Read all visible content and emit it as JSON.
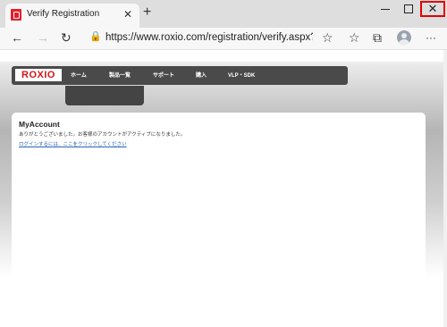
{
  "browser": {
    "tab": {
      "title": "Verify Registration",
      "close_glyph": "✕",
      "favicon": "roxio-favicon"
    },
    "new_tab_glyph": "+",
    "window_controls": {
      "close_glyph": "✕",
      "highlight_color": "#e60000"
    },
    "toolbar": {
      "back_glyph": "←",
      "forward_glyph": "→",
      "refresh_glyph": "↻",
      "lock_glyph": "🔒",
      "url": "https://www.roxio.com/registration/verify.aspx?ve...",
      "favorite_glyph": "☆",
      "favorites_list_glyph": "☆",
      "collections_glyph": "⧉"
    }
  },
  "page": {
    "logo_text": "ROXIO",
    "nav": {
      "items": [
        "ホーム",
        "製品一覧",
        "サポート",
        "購入",
        "VLP・SDK"
      ]
    },
    "card": {
      "title": "MyAccount",
      "message": "ありがとうございました。お客様のアカウントがアクティブになりました。",
      "login_link": "ログインするには、ここをクリックしてください"
    },
    "colors": {
      "brand_red": "#d3141c",
      "navbar": "#4a4a4a",
      "link": "#2a63b5"
    }
  }
}
